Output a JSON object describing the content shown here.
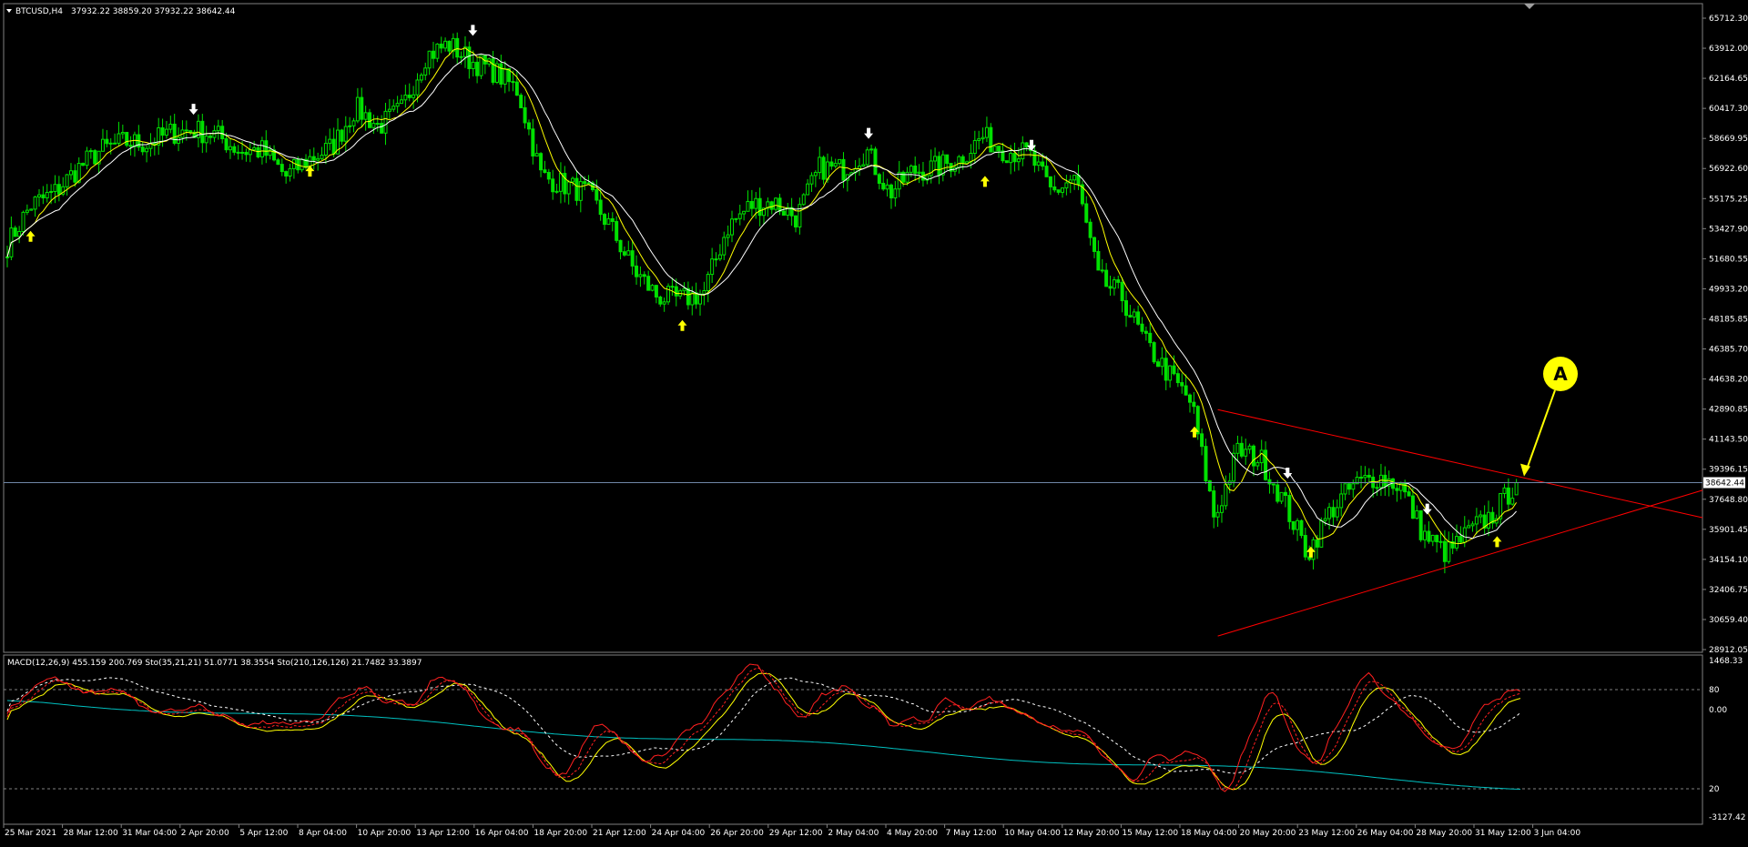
{
  "header": {
    "symbol": "BTCUSD,H4",
    "ohlc": "37932.22 38859.20 37932.22 38642.44"
  },
  "price_axis": {
    "ticks": [
      "65712.30",
      "63912.00",
      "62164.65",
      "60417.30",
      "58669.95",
      "56922.60",
      "55175.25",
      "53427.90",
      "51680.55",
      "49933.20",
      "48185.85",
      "46385.70",
      "44638.20",
      "42890.85",
      "41143.50",
      "39396.15",
      "37648.80",
      "35901.45",
      "34154.10",
      "32406.75",
      "30659.40",
      "28912.05"
    ],
    "current_price_label": "38642.44"
  },
  "sub_window": {
    "label": "MACD(12,26,9) 455.159 200.769  Sto(35,21,21) 51.0771 38.3554  Sto(210,126,126) 21.7482 33.3897",
    "axis_labels": [
      "1468.33",
      "80",
      "0.00",
      "20",
      "-3127.42"
    ]
  },
  "time_axis": {
    "labels": [
      "25 Mar 2021",
      "28 Mar 12:00",
      "31 Mar 04:00",
      "2 Apr 20:00",
      "5 Apr 12:00",
      "8 Apr 04:00",
      "10 Apr 20:00",
      "13 Apr 12:00",
      "16 Apr 04:00",
      "18 Apr 20:00",
      "21 Apr 12:00",
      "24 Apr 04:00",
      "26 Apr 20:00",
      "29 Apr 12:00",
      "2 May 04:00",
      "4 May 20:00",
      "7 May 12:00",
      "10 May 04:00",
      "12 May 20:00",
      "15 May 12:00",
      "18 May 04:00",
      "20 May 20:00",
      "23 May 12:00",
      "26 May 04:00",
      "28 May 20:00",
      "31 May 12:00",
      "3 Jun 04:00"
    ]
  },
  "annotation": {
    "label": "A"
  },
  "colors": {
    "bullish": "#00e000",
    "ma_fast": "#ffff00",
    "ma_slow": "#ffffff",
    "trendline": "#ff0000",
    "up_arrow": "#ffff00",
    "down_arrow": "#ffffff",
    "osc_fast": "#ff2020",
    "osc_slow": "#ffff00",
    "osc_long_a": "#ffffff",
    "osc_long_b": "#00c0c0",
    "osc_level": "#808080"
  },
  "chart_data": {
    "type": "candlestick",
    "symbol": "BTCUSD",
    "timeframe": "H4",
    "ylim": [
      28912.05,
      66600
    ],
    "price_path": [
      {
        "t": "25 Mar 2021",
        "p": 52500
      },
      {
        "t": "26 Mar",
        "p": 54800
      },
      {
        "t": "27 Mar",
        "p": 55500
      },
      {
        "t": "28 Mar 12:00",
        "p": 56900
      },
      {
        "t": "29 Mar",
        "p": 58000
      },
      {
        "t": "30 Mar",
        "p": 58500
      },
      {
        "t": "31 Mar 04:00",
        "p": 58400
      },
      {
        "t": "1 Apr",
        "p": 59000
      },
      {
        "t": "2 Apr",
        "p": 59200
      },
      {
        "t": "2 Apr 20:00",
        "p": 58900
      },
      {
        "t": "4 Apr",
        "p": 58000
      },
      {
        "t": "5 Apr 12:00",
        "p": 58000
      },
      {
        "t": "7 Apr",
        "p": 56500
      },
      {
        "t": "8 Apr 04:00",
        "p": 57500
      },
      {
        "t": "9 Apr",
        "p": 58200
      },
      {
        "t": "10 Apr",
        "p": 60500
      },
      {
        "t": "10 Apr 20:00",
        "p": 59400
      },
      {
        "t": "12 Apr",
        "p": 60400
      },
      {
        "t": "13 Apr 12:00",
        "p": 63500
      },
      {
        "t": "14 Apr",
        "p": 64200
      },
      {
        "t": "15 Apr",
        "p": 63200
      },
      {
        "t": "16 Apr 04:00",
        "p": 62600
      },
      {
        "t": "17 Apr",
        "p": 61500
      },
      {
        "t": "18 Apr",
        "p": 56500
      },
      {
        "t": "18 Apr 20:00",
        "p": 56000
      },
      {
        "t": "20 Apr",
        "p": 55500
      },
      {
        "t": "21 Apr 12:00",
        "p": 53500
      },
      {
        "t": "22 Apr",
        "p": 51000
      },
      {
        "t": "23 Apr",
        "p": 49500
      },
      {
        "t": "24 Apr 04:00",
        "p": 49300
      },
      {
        "t": "25 Apr",
        "p": 49700
      },
      {
        "t": "26 Apr",
        "p": 53500
      },
      {
        "t": "26 Apr 20:00",
        "p": 54800
      },
      {
        "t": "28 Apr",
        "p": 55000
      },
      {
        "t": "29 Apr 12:00",
        "p": 54100
      },
      {
        "t": "1 May",
        "p": 57000
      },
      {
        "t": "2 May 04:00",
        "p": 56900
      },
      {
        "t": "3 May",
        "p": 58000
      },
      {
        "t": "4 May",
        "p": 55500
      },
      {
        "t": "4 May 20:00",
        "p": 56800
      },
      {
        "t": "6 May",
        "p": 57000
      },
      {
        "t": "7 May 12:00",
        "p": 57500
      },
      {
        "t": "8 May",
        "p": 58800
      },
      {
        "t": "9 May",
        "p": 58000
      },
      {
        "t": "10 May 04:00",
        "p": 57800
      },
      {
        "t": "11 May",
        "p": 55500
      },
      {
        "t": "12 May",
        "p": 56500
      },
      {
        "t": "12 May 20:00",
        "p": 50500
      },
      {
        "t": "14 May",
        "p": 49500
      },
      {
        "t": "15 May 12:00",
        "p": 46800
      },
      {
        "t": "17 May",
        "p": 45000
      },
      {
        "t": "18 May 04:00",
        "p": 43300
      },
      {
        "t": "19 May",
        "p": 36500
      },
      {
        "t": "19 May 12:00",
        "p": 40500
      },
      {
        "t": "20 May 20:00",
        "p": 40000
      },
      {
        "t": "22 May",
        "p": 37500
      },
      {
        "t": "23 May",
        "p": 34500
      },
      {
        "t": "23 May 12:00",
        "p": 37000
      },
      {
        "t": "25 May",
        "p": 38500
      },
      {
        "t": "26 May 04:00",
        "p": 39000
      },
      {
        "t": "27 May",
        "p": 38500
      },
      {
        "t": "28 May 20:00",
        "p": 35600
      },
      {
        "t": "30 May",
        "p": 34500
      },
      {
        "t": "31 May 12:00",
        "p": 35800
      },
      {
        "t": "2 Jun",
        "p": 36800
      },
      {
        "t": "3 Jun 04:00",
        "p": 38642
      }
    ],
    "last_ohlc": {
      "open": 37932.22,
      "high": 38859.2,
      "low": 37932.22,
      "close": 38642.44
    },
    "current_price": 38642.44,
    "moving_averages": [
      "fast (yellow)",
      "slow (white)"
    ],
    "signals": [
      {
        "dir": "up",
        "t": "26 Mar",
        "p": 53000
      },
      {
        "dir": "down",
        "t": "2 Apr",
        "p": 60400
      },
      {
        "dir": "up",
        "t": "8 Apr",
        "p": 56800
      },
      {
        "dir": "down",
        "t": "15 Apr",
        "p": 65000
      },
      {
        "dir": "up",
        "t": "24 Apr",
        "p": 47800
      },
      {
        "dir": "down",
        "t": "3 May",
        "p": 59000
      },
      {
        "dir": "up",
        "t": "8 May",
        "p": 56200
      },
      {
        "dir": "down",
        "t": "10 May",
        "p": 58300
      },
      {
        "dir": "up",
        "t": "18 May",
        "p": 41600
      },
      {
        "dir": "down",
        "t": "22 May",
        "p": 39200
      },
      {
        "dir": "up",
        "t": "23 May",
        "p": 34600
      },
      {
        "dir": "down",
        "t": "28 May",
        "p": 37100
      },
      {
        "dir": "up",
        "t": "2 Jun",
        "p": 35200
      }
    ],
    "trendlines": [
      {
        "name": "upper",
        "from": {
          "t": "19 May",
          "p": 42900
        },
        "to": {
          "t": "3 Jun 04:00+",
          "p": 36600
        }
      },
      {
        "name": "lower",
        "from": {
          "t": "19 May",
          "p": 29700
        },
        "to": {
          "t": "3 Jun 04:00+",
          "p": 38200
        }
      }
    ],
    "annotation": {
      "label": "A",
      "target_price": 38900
    }
  }
}
